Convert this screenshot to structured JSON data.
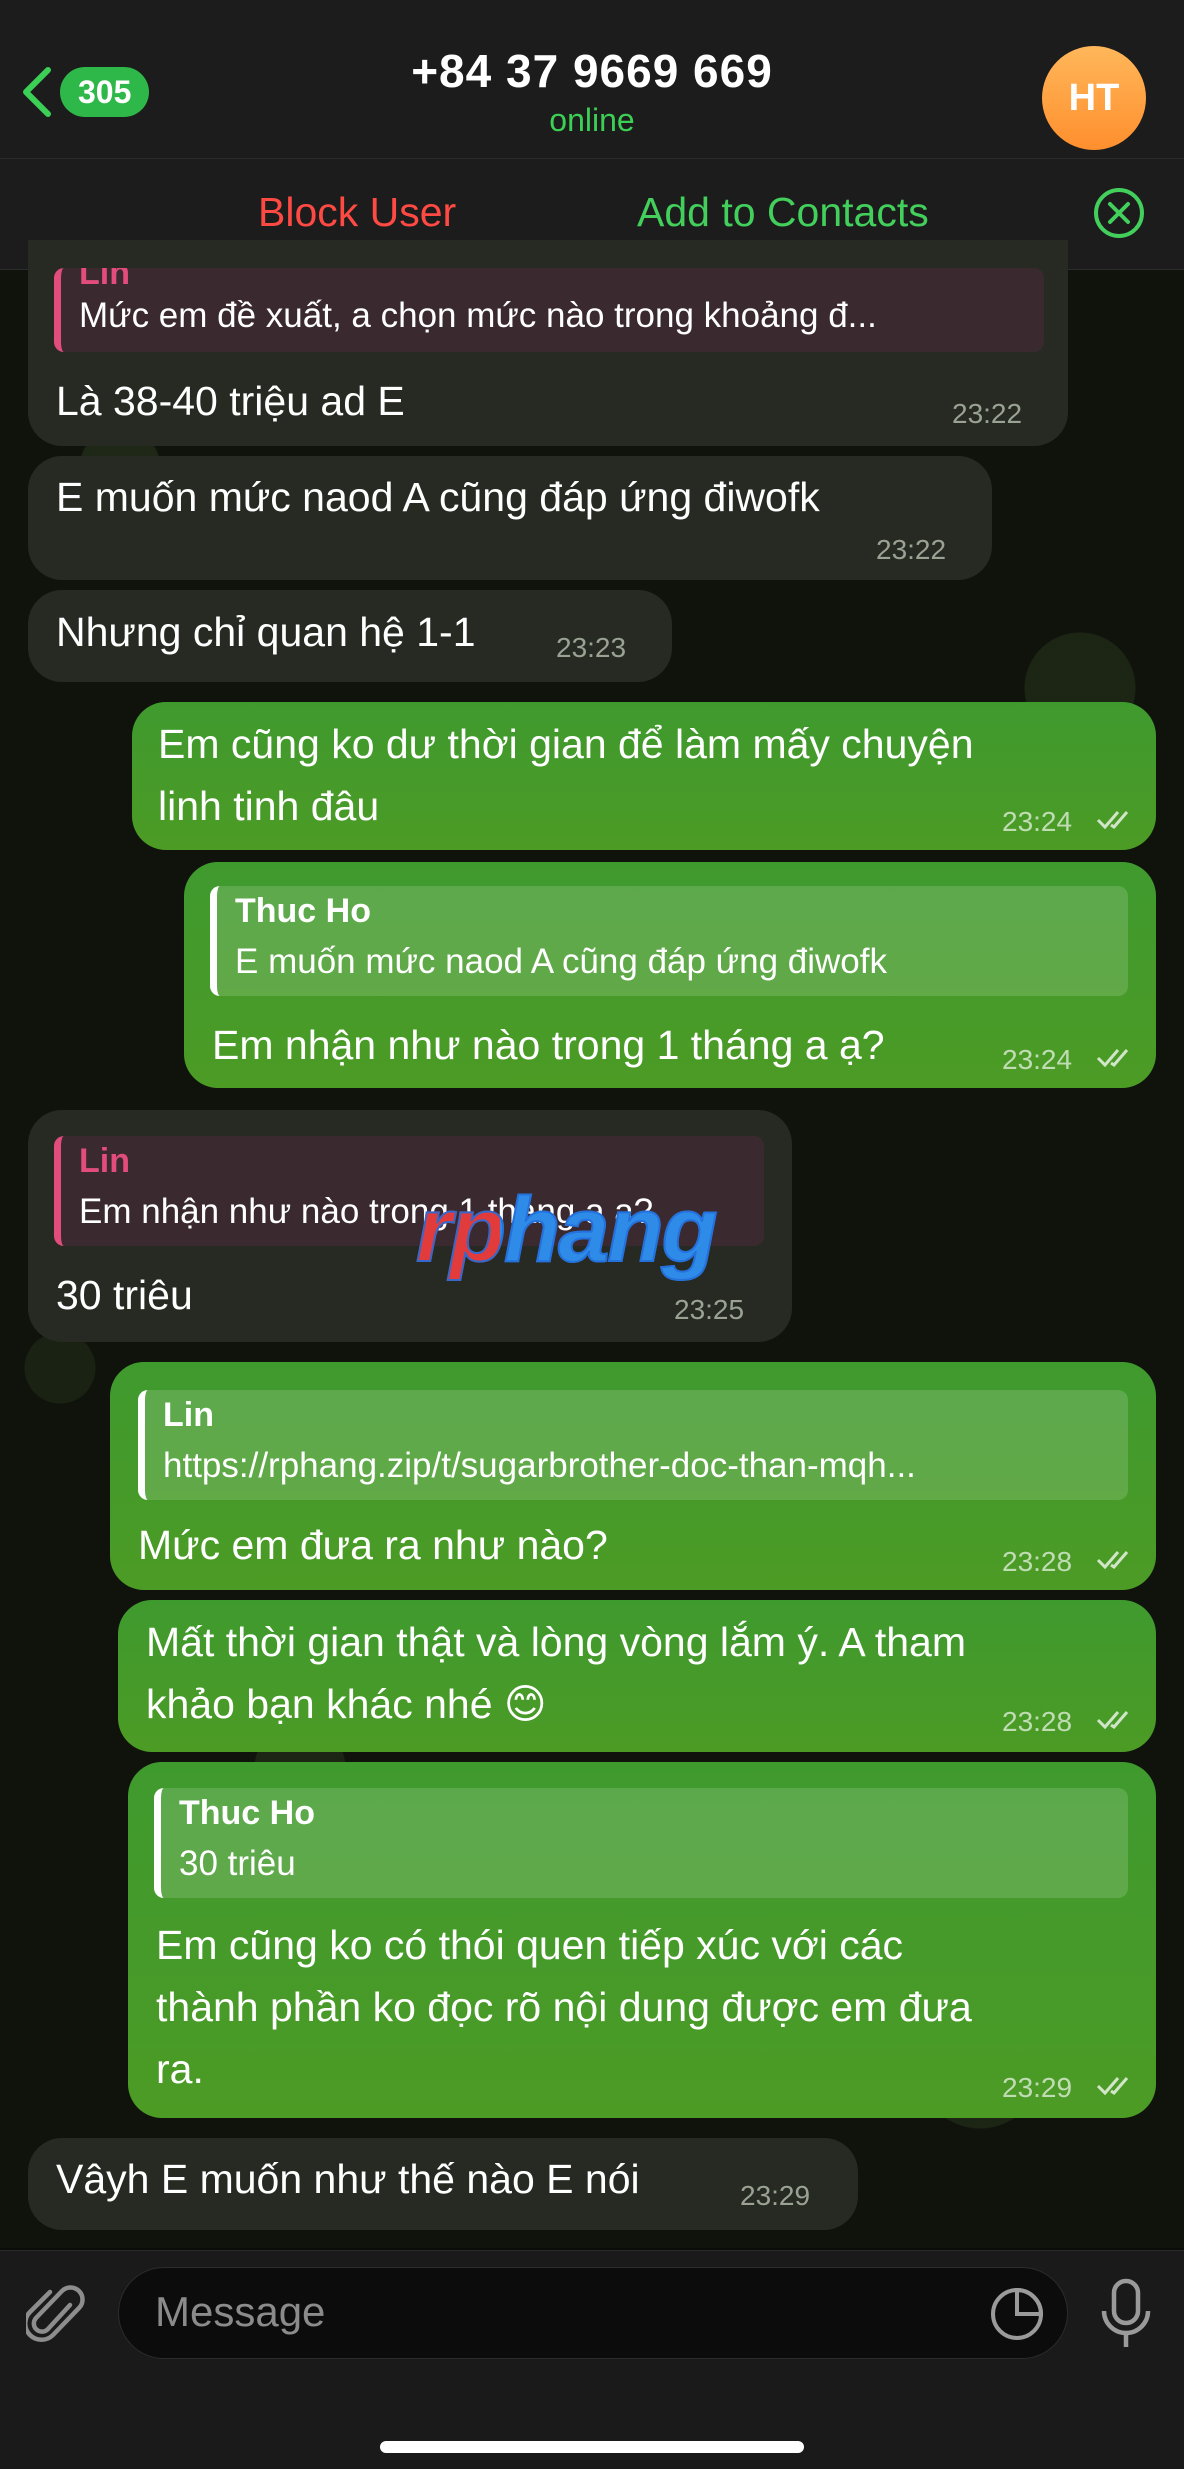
{
  "header": {
    "back_badge": "305",
    "title": "+84 37 9669 669",
    "status": "online",
    "avatar_initials": "HT"
  },
  "action_bar": {
    "block_label": "Block User",
    "add_label": "Add to Contacts"
  },
  "messages": [
    {
      "dir": "in",
      "reply_name": "Lin",
      "reply_text": "Mức em đề xuất, a chọn mức nào trong khoảng đ...",
      "lines": [
        "Là 38-40 triệu ad E"
      ],
      "time": "23:22"
    },
    {
      "dir": "in",
      "lines": [
        "E muốn mức naod A cũng đáp ứng điwofk"
      ],
      "time": "23:22"
    },
    {
      "dir": "in",
      "lines": [
        "Nhưng chỉ quan hệ 1-1"
      ],
      "time": "23:23"
    },
    {
      "dir": "out",
      "lines": [
        "Em cũng ko dư thời gian để làm mấy chuyện",
        "linh tinh đâu"
      ],
      "time": "23:24"
    },
    {
      "dir": "out",
      "reply_name": "Thuc Ho",
      "reply_text": "E muốn mức naod A cũng đáp ứng điwofk",
      "lines": [
        "Em nhận như nào trong 1 tháng a ạ?"
      ],
      "time": "23:24"
    },
    {
      "dir": "in",
      "reply_name": "Lin",
      "reply_text": "Em nhận như nào trong 1 tháng a ạ?",
      "lines": [
        "30 triêu"
      ],
      "time": "23:25"
    },
    {
      "dir": "out",
      "reply_name": "Lin",
      "reply_text": "https://rphang.zip/t/sugarbrother-doc-than-mqh...",
      "lines": [
        "Mức em đưa ra như nào?"
      ],
      "time": "23:28"
    },
    {
      "dir": "out",
      "lines": [
        "Mất thời gian thật và lòng vòng lắm ý. A tham",
        "khảo bạn khác nhé 😊"
      ],
      "time": "23:28"
    },
    {
      "dir": "out",
      "reply_name": "Thuc Ho",
      "reply_text": "30 triêu",
      "lines": [
        "Em cũng ko có thói quen tiếp xúc với các",
        "thành phần ko đọc rõ nội dung được em đưa",
        "ra."
      ],
      "time": "23:29"
    },
    {
      "dir": "in",
      "lines": [
        "Vâyh E muốn như thế nào E nói"
      ],
      "time": "23:29"
    }
  ],
  "watermark": "rphang",
  "composer": {
    "placeholder": "Message"
  },
  "colors": {
    "outgoing_bubble": "#45a02a",
    "incoming_bubble": "#262a22",
    "online": "#3ccf55",
    "block": "#ff4a43",
    "add": "#42cf5b",
    "reply_accent_in": "#e34d7e"
  },
  "icons": [
    "back-chevron-icon",
    "close-circle-icon",
    "paperclip-icon",
    "sticker-icon",
    "microphone-icon",
    "double-check-icon"
  ]
}
